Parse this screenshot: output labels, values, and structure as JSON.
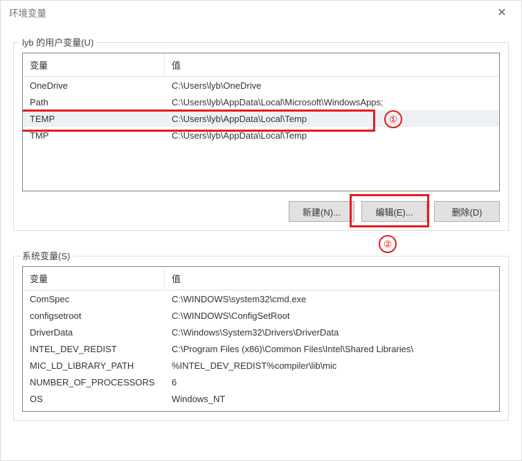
{
  "window": {
    "title": "环境变量"
  },
  "user_group": {
    "legend": "lyb 的用户变量(U)",
    "headers": {
      "name": "变量",
      "value": "值"
    },
    "rows": [
      {
        "name": "OneDrive",
        "value": "C:\\Users\\lyb\\OneDrive"
      },
      {
        "name": "Path",
        "value": "C:\\Users\\lyb\\AppData\\Local\\Microsoft\\WindowsApps;"
      },
      {
        "name": "TEMP",
        "value": "C:\\Users\\lyb\\AppData\\Local\\Temp"
      },
      {
        "name": "TMP",
        "value": "C:\\Users\\lyb\\AppData\\Local\\Temp"
      }
    ],
    "selected_index": 2,
    "buttons": {
      "new": "新建(N)...",
      "edit": "编辑(E)...",
      "delete": "删除(D)"
    }
  },
  "system_group": {
    "legend": "系统变量(S)",
    "headers": {
      "name": "变量",
      "value": "值"
    },
    "rows": [
      {
        "name": "ComSpec",
        "value": "C:\\WINDOWS\\system32\\cmd.exe"
      },
      {
        "name": "configsetroot",
        "value": "C:\\WINDOWS\\ConfigSetRoot"
      },
      {
        "name": "DriverData",
        "value": "C:\\Windows\\System32\\Drivers\\DriverData"
      },
      {
        "name": "INTEL_DEV_REDIST",
        "value": "C:\\Program Files (x86)\\Common Files\\Intel\\Shared Libraries\\"
      },
      {
        "name": "MIC_LD_LIBRARY_PATH",
        "value": "%INTEL_DEV_REDIST%compiler\\lib\\mic"
      },
      {
        "name": "NUMBER_OF_PROCESSORS",
        "value": "6"
      },
      {
        "name": "OS",
        "value": "Windows_NT"
      }
    ]
  },
  "annotations": {
    "circle1": "①",
    "circle2": "②"
  }
}
